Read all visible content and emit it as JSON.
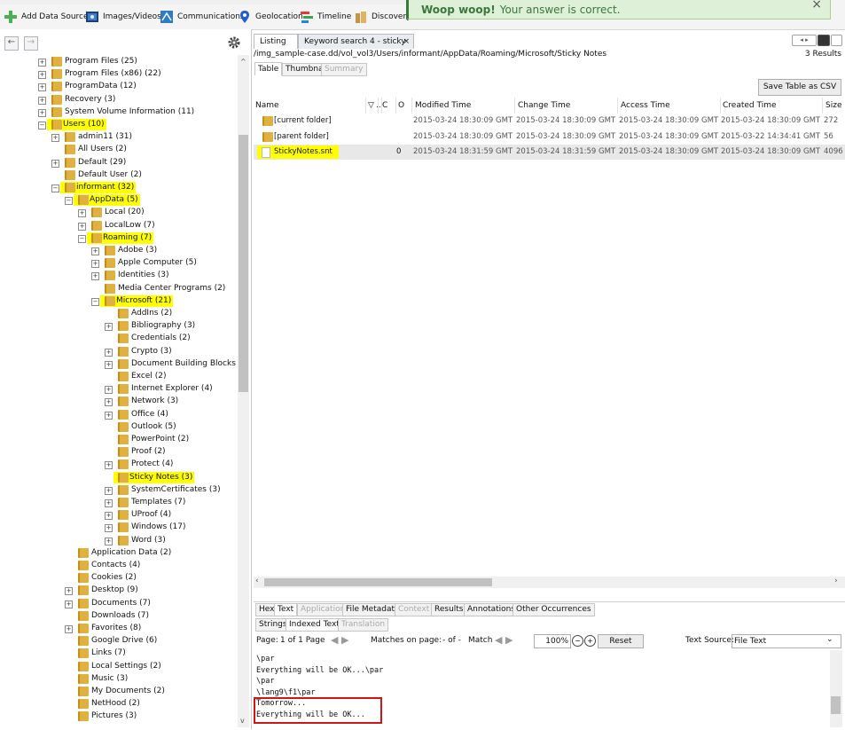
{
  "toolbar": {
    "items": [
      {
        "label": "Add Data Source",
        "icon": "plus-icon"
      },
      {
        "label": "Images/Videos",
        "icon": "images-icon"
      },
      {
        "label": "Communications",
        "icon": "communications-icon"
      },
      {
        "label": "Geolocation",
        "icon": "location-pin-icon"
      },
      {
        "label": "Timeline",
        "icon": "timeline-icon"
      },
      {
        "label": "Discovery",
        "icon": "discovery-icon"
      }
    ]
  },
  "notification": {
    "title": "Woop woop!",
    "message": "Your answer is correct.",
    "close": "×"
  },
  "nav": {
    "back": "←",
    "forward": "→"
  },
  "tree": {
    "nodes": [
      {
        "label": "Program Files (25)"
      },
      {
        "label": "Program Files (x86) (22)"
      },
      {
        "label": "ProgramData (12)"
      },
      {
        "label": "Recovery (3)"
      },
      {
        "label": "System Volume Information (11)"
      },
      {
        "label": "Users (10)"
      },
      {
        "label": "admin11 (31)"
      },
      {
        "label": "All Users (2)"
      },
      {
        "label": "Default (29)"
      },
      {
        "label": "Default User (2)"
      },
      {
        "label": "informant (32)"
      },
      {
        "label": "AppData (5)"
      },
      {
        "label": "Local (20)"
      },
      {
        "label": "LocalLow (7)"
      },
      {
        "label": "Roaming (7)"
      },
      {
        "label": "Adobe (3)"
      },
      {
        "label": "Apple Computer (5)"
      },
      {
        "label": "Identities (3)"
      },
      {
        "label": "Media Center Programs (2)"
      },
      {
        "label": "Microsoft (21)"
      },
      {
        "label": "AddIns (2)"
      },
      {
        "label": "Bibliography (3)"
      },
      {
        "label": "Credentials (2)"
      },
      {
        "label": "Crypto (3)"
      },
      {
        "label": "Document Building Blocks (3)"
      },
      {
        "label": "Excel (2)"
      },
      {
        "label": "Internet Explorer (4)"
      },
      {
        "label": "Network (3)"
      },
      {
        "label": "Office (4)"
      },
      {
        "label": "Outlook (5)"
      },
      {
        "label": "PowerPoint (2)"
      },
      {
        "label": "Proof (2)"
      },
      {
        "label": "Protect (4)"
      },
      {
        "label": "Sticky Notes (3)"
      },
      {
        "label": "SystemCertificates (3)"
      },
      {
        "label": "Templates (7)"
      },
      {
        "label": "UProof (4)"
      },
      {
        "label": "Windows (17)"
      },
      {
        "label": "Word (3)"
      },
      {
        "label": "Application Data (2)"
      },
      {
        "label": "Contacts (4)"
      },
      {
        "label": "Cookies (2)"
      },
      {
        "label": "Desktop (9)"
      },
      {
        "label": "Documents (7)"
      },
      {
        "label": "Downloads (7)"
      },
      {
        "label": "Favorites (8)"
      },
      {
        "label": "Google Drive (6)"
      },
      {
        "label": "Links (7)"
      },
      {
        "label": "Local Settings (2)"
      },
      {
        "label": "Music (3)"
      },
      {
        "label": "My Documents (2)"
      },
      {
        "label": "NetHood (2)"
      },
      {
        "label": "Pictures (3)"
      }
    ]
  },
  "tabs": [
    {
      "label": "Listing"
    },
    {
      "label": "Keyword search 4 - sticky",
      "close": "×"
    }
  ],
  "path": "/img_sample-case.dd/vol_vol3/Users/informant/AppData/Roaming/Microsoft/Sticky Notes",
  "results_count": "3  Results",
  "view_tabs": {
    "table": "Table",
    "thumbnail": "Thumbnail",
    "summary": "Summary"
  },
  "save_csv": "Save Table as CSV",
  "columns": {
    "name": "Name",
    "s": "▽",
    "dots": "..",
    "c": "C",
    "o": "O",
    "modified": "Modified Time",
    "change": "Change Time",
    "access": "Access Time",
    "created": "Created Time",
    "size": "Size"
  },
  "rows": [
    {
      "name": "[current folder]",
      "o": "",
      "modified": "2015-03-24 18:30:09 GMT",
      "change": "2015-03-24 18:30:09 GMT",
      "access": "2015-03-24 18:30:09 GMT",
      "created": "2015-03-24 18:30:09 GMT",
      "size": "272"
    },
    {
      "name": "[parent folder]",
      "o": "",
      "modified": "2015-03-24 18:30:09 GMT",
      "change": "2015-03-24 18:30:09 GMT",
      "access": "2015-03-24 18:30:09 GMT",
      "created": "2015-03-22 14:34:41 GMT",
      "size": "56"
    },
    {
      "name": "StickyNotes.snt",
      "o": "0",
      "modified": "2015-03-24 18:31:59 GMT",
      "change": "2015-03-24 18:31:59 GMT",
      "access": "2015-03-24 18:30:09 GMT",
      "created": "2015-03-24 18:30:09 GMT",
      "size": "4096"
    }
  ],
  "bottom_tabs": {
    "hex": "Hex",
    "text": "Text",
    "application": "Application",
    "file_metadata": "File Metadata",
    "context": "Context",
    "results": "Results",
    "annotations": "Annotations",
    "other": "Other Occurrences"
  },
  "text_subtabs": {
    "strings": "Strings",
    "indexed": "Indexed Text",
    "translation": "Translation"
  },
  "controls": {
    "page_label": "Page:",
    "page_value": "1 of 1 Page",
    "matches_label": "Matches on page:",
    "matches_value": "- of -",
    "match_label": "Match",
    "zoom": "100%",
    "reset": "Reset",
    "source_label": "Text Source:",
    "source_value": "File Text"
  },
  "text_lines": [
    "\\par",
    "Everything will be OK...\\par",
    "\\par",
    "\\lang9\\f1\\par",
    "Tomorrow...",
    "Everything will be OK..."
  ]
}
